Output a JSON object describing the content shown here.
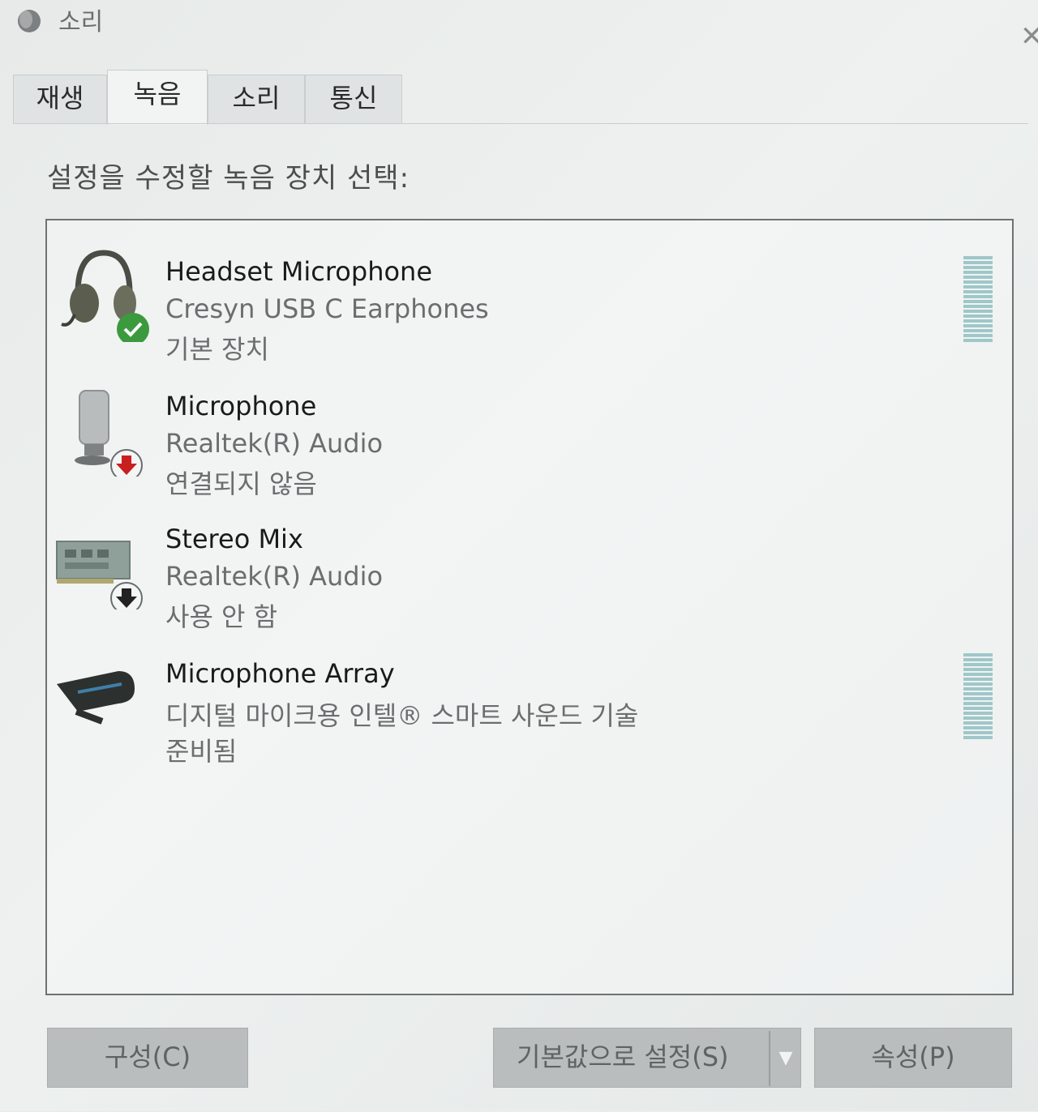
{
  "window": {
    "title": "소리",
    "icon": "speaker-app-icon",
    "close_icon": "close-icon"
  },
  "tabs": [
    {
      "label": "재생",
      "active": false
    },
    {
      "label": "녹음",
      "active": true
    },
    {
      "label": "소리",
      "active": false
    },
    {
      "label": "통신",
      "active": false
    }
  ],
  "prompt": "설정을 수정할 녹음 장치 선택:",
  "devices": [
    {
      "name": "Headset Microphone",
      "driver": "Cresyn  USB C Earphones",
      "status": "기본 장치",
      "icon": "headset-icon",
      "badge": "default-check-icon",
      "level_meter": true
    },
    {
      "name": "Microphone",
      "driver": "Realtek(R) Audio",
      "status": "연결되지 않음",
      "icon": "microphone-icon",
      "badge": "disconnected-icon",
      "level_meter": false
    },
    {
      "name": "Stereo Mix",
      "driver": "Realtek(R) Audio",
      "status": "사용 안 함",
      "icon": "sound-card-icon",
      "badge": "disabled-icon",
      "level_meter": false
    },
    {
      "name": "Microphone Array",
      "driver": "디지털 마이크용 인텔® 스마트 사운드 기술",
      "status": "준비됨",
      "icon": "mic-array-icon",
      "badge": "",
      "level_meter": true
    }
  ],
  "buttons": {
    "configure": "구성(C)",
    "set_default": "기본값으로 설정(S)",
    "set_default_dropdown_icon": "chevron-down-icon",
    "properties": "속성(P)"
  },
  "colors": {
    "default_badge": "#3b9a3e",
    "disconnected_badge": "#c8201e",
    "level_meter": "#9fc7c9"
  }
}
